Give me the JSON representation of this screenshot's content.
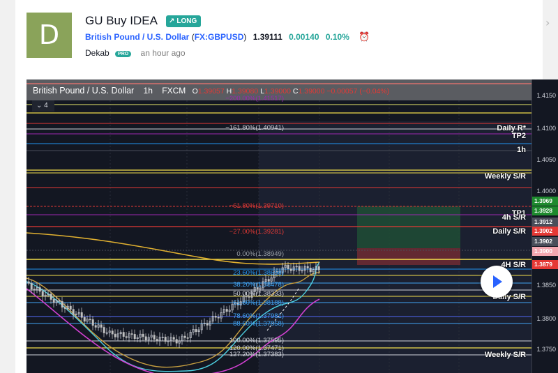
{
  "idea": {
    "avatar_letter": "D",
    "title": "GU Buy IDEA",
    "direction_label": "LONG",
    "symbol_name": "British Pound / U.S. Dollar",
    "ticker": "FX:GBPUSD",
    "price": "1.39111",
    "change": "0.00140",
    "change_pct": "0.10%",
    "author": "Dekab",
    "author_badge": "PRO",
    "time_ago": "an hour ago"
  },
  "chart": {
    "symbol": "British Pound / U.S. Dollar",
    "timeframe": "1h",
    "source": "FXCM",
    "ohlc": {
      "o_label": "O",
      "o": "1.39057",
      "h_label": "H",
      "h": "1.39080",
      "l_label": "L",
      "l": "1.39000",
      "c_label": "C",
      "c": "1.39000",
      "chg": "−0.00057 (−0.04%)"
    },
    "indicator_count": "4",
    "axis_ticks": [
      "1.4150",
      "1.4100",
      "1.4050",
      "1.4000",
      "1.3850",
      "1.3800",
      "1.3750"
    ],
    "price_tags": [
      {
        "text": "1.3969",
        "color": "#1e8a2e"
      },
      {
        "text": "1.3928",
        "color": "#1e8a2e"
      },
      {
        "text": "1.3912",
        "color": "#4a4e5a"
      },
      {
        "text": "1.3902",
        "color": "#e53935"
      },
      {
        "text": "1.3902",
        "color": "#4a4e5a"
      },
      {
        "text": "1.3900",
        "color": "#f4a7b0"
      },
      {
        "text": "1.3879",
        "color": "#e53935"
      }
    ],
    "level_labels": {
      "daily_r": "Daily R*",
      "tp2": "TP2",
      "h1": "1h",
      "weekly_sr_top": "Weekly S/R",
      "tp1": "TP1",
      "h4_sr_top": "4h S/R",
      "daily_sr_top": "Daily S/R",
      "h4_sr_bottom": "4H S/R",
      "daily_sr_bottom": "Daily S/R",
      "weekly_sr_bottom": "Weekly S/R"
    },
    "fib_labels": [
      {
        "text": "−200.00%(1.41517)",
        "color": "#9c27b0"
      },
      {
        "text": "−161.80%(1.40941)",
        "color": "#d1d4dc"
      },
      {
        "text": "−61.80%(1.39710)",
        "color": "#e53935"
      },
      {
        "text": "−27.00%(1.39281)",
        "color": "#e53935"
      },
      {
        "text": "0.00%(1.38949)",
        "color": "#9aa0a8"
      },
      {
        "text": "23.60%(1.38658)",
        "color": "#2196f3"
      },
      {
        "text": "38.20%(1.38478)",
        "color": "#42a5f5"
      },
      {
        "text": "50.00%(1.38333)",
        "color": "#d1d4dc"
      },
      {
        "text": "61.80%(1.38188)",
        "color": "#42a5f5"
      },
      {
        "text": "78.60%(1.37981)",
        "color": "#42a5f5"
      },
      {
        "text": "88.60%(1.37858)",
        "color": "#42a5f5"
      },
      {
        "text": "100.00%(1.37595)",
        "color": "#d1d4dc"
      },
      {
        "text": "120.00%(1.37471)",
        "color": "#d1d4dc"
      },
      {
        "text": "127.20%(1.37383)",
        "color": "#d1d4dc"
      }
    ]
  }
}
